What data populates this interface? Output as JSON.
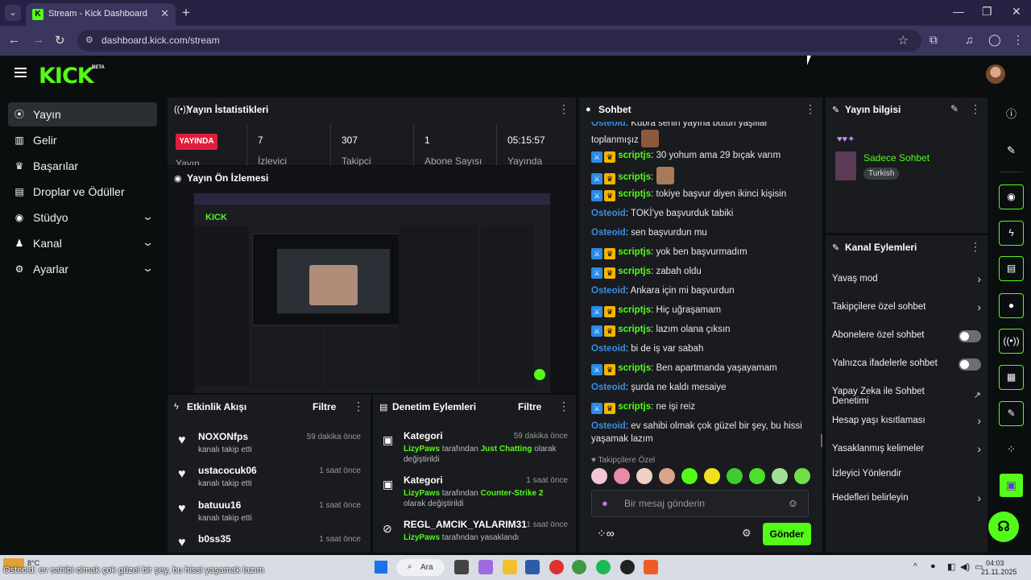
{
  "browser": {
    "tab_title": "Stream - Kick Dashboard",
    "url": "dashboard.kick.com/stream"
  },
  "header": {
    "logo": "KICK",
    "beta": "BETA"
  },
  "sidebar": {
    "items": [
      {
        "label": "Yayın",
        "icon": "broadcast-icon"
      },
      {
        "label": "Gelir",
        "icon": "chart-icon"
      },
      {
        "label": "Başarılar",
        "icon": "trophy-icon"
      },
      {
        "label": "Droplar ve Ödüller",
        "icon": "gift-icon"
      },
      {
        "label": "Stüdyo",
        "icon": "camera-icon"
      },
      {
        "label": "Kanal",
        "icon": "users-icon"
      },
      {
        "label": "Ayarlar",
        "icon": "gear-icon"
      }
    ]
  },
  "stats": {
    "title": "Yayın İstatistikleri",
    "live_label": "YAYINDA",
    "live_sub": "Yayın",
    "items": [
      {
        "value": "7",
        "label": "İzlevici"
      },
      {
        "value": "307",
        "label": "Takipci"
      },
      {
        "value": "1",
        "label": "Abone Sayısı"
      },
      {
        "value": "05:15:57",
        "label": "Yayında"
      }
    ]
  },
  "preview": {
    "title": "Yayın Ön İzlemesi"
  },
  "activity": {
    "title": "Etkinlik Akışı",
    "filter": "Filtre",
    "items": [
      {
        "name": "NOXONfps",
        "text": "kanalı takip etti",
        "time": "59 dakika önce"
      },
      {
        "name": "ustacocuk06",
        "text": "kanalı takip etti",
        "time": "1 saat önce"
      },
      {
        "name": "batuuu16",
        "text": "kanalı takip etti",
        "time": "1 saat önce"
      },
      {
        "name": "b0ss35",
        "text": "",
        "time": "1 saat önce"
      }
    ]
  },
  "moderation": {
    "title": "Denetim Eylemleri",
    "filter": "Filtre",
    "items": [
      {
        "name": "Kategori",
        "time": "59 dakika önce",
        "user": "LizyPaws",
        "mid": " tarafından ",
        "target": "Just Chatting",
        "tail": " olarak değiştirildi"
      },
      {
        "name": "Kategori",
        "time": "1 saat önce",
        "user": "LizyPaws",
        "mid": " tarafından ",
        "target": "Counter-Strike 2",
        "tail": " olarak değiştirildi"
      },
      {
        "name": "REGL_AMCIK_YALARIM31",
        "time": "1 saat önce",
        "user": "LizyPaws",
        "mid": " tarafından yasaklandı",
        "target": "",
        "tail": ""
      }
    ]
  },
  "chat": {
    "title": "Sohbet",
    "messages": [
      {
        "user": "Osteoid",
        "text": "Kübra senin yayına bütün yaşlılar toplanmışız",
        "badges": false,
        "emote": true
      },
      {
        "user": "scriptjs",
        "text": "30 yohum ama 29 bıçak varım",
        "badges": true
      },
      {
        "user": "scriptjs",
        "text": "",
        "badges": true,
        "emote": true
      },
      {
        "user": "scriptjs",
        "text": "tokiye başvur diyen ikinci kişisin",
        "badges": true
      },
      {
        "user": "Osteoid",
        "text": "TOKİ'ye başvurduk tabiki",
        "badges": false
      },
      {
        "user": "Osteoid",
        "text": "sen başvurdun mu",
        "badges": false
      },
      {
        "user": "scriptjs",
        "text": "yok ben başvurmadım",
        "badges": true
      },
      {
        "user": "scriptjs",
        "text": "zabah oldu",
        "badges": true
      },
      {
        "user": "Osteoid",
        "text": "Ankara için mi başvurdun",
        "badges": false
      },
      {
        "user": "scriptjs",
        "text": "Hiç uğraşamam",
        "badges": true
      },
      {
        "user": "scriptjs",
        "text": "lazım olana çıksın",
        "badges": true
      },
      {
        "user": "Osteoid",
        "text": "bi de iş var sabah",
        "badges": false
      },
      {
        "user": "scriptjs",
        "text": "Ben apartmanda yaşayamam",
        "badges": true
      },
      {
        "user": "Osteoid",
        "text": "şurda ne kaldı mesaiye",
        "badges": false
      },
      {
        "user": "scriptjs",
        "text": "ne işi reiz",
        "badges": true
      },
      {
        "user": "Osteoid",
        "text": "ev sahibi olmak çok güzel bir şey, bu hissi yaşamak lazım",
        "badges": false
      }
    ],
    "followers_only": "Takipçilere Özel",
    "input_placeholder": "Bir mesaj gönderin",
    "send_label": "Gönder"
  },
  "info": {
    "title": "Yayın bilgisi",
    "stream_title": "Sadece Sohbet",
    "tag": "Turkish"
  },
  "channel_actions": {
    "title": "Kanal Eylemleri",
    "items": [
      {
        "label": "Yavaş mod",
        "control": "chevron"
      },
      {
        "label": "Takipçilere özel sohbet",
        "control": "chevron"
      },
      {
        "label": "Abonelere özel sohbet",
        "control": "toggle"
      },
      {
        "label": "Yalnızca ifadelerle sohbet",
        "control": "toggle"
      },
      {
        "label": "Yapay Zeka ile Sohbet Denetimi",
        "control": "external"
      },
      {
        "label": "Hesap yaşı kısıtlaması",
        "control": "chevron"
      },
      {
        "label": "Yasaklanmış kelimeler",
        "control": "chevron"
      },
      {
        "label": "İzleyici Yönlendir",
        "control": "none"
      },
      {
        "label": "Hedefleri belirleyin",
        "control": "chevron"
      }
    ]
  },
  "taskbar": {
    "weather": "8°C",
    "search": "Ara",
    "time": "04:03",
    "date": "21.11.2025"
  },
  "overlay_caption": "Osteoid: ev sahibi olmak çok güzel bir şey, bu hissi yaşamak lazım",
  "colors": {
    "accent": "#53fc18",
    "live": "#e01e3c",
    "mod_user": "#3c8de0"
  }
}
